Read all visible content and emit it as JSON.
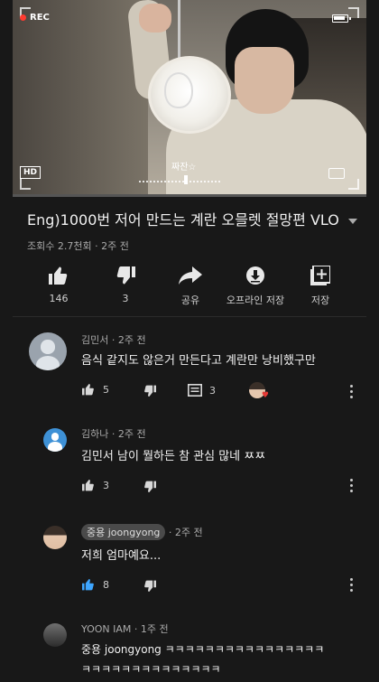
{
  "video": {
    "rec_label": "REC",
    "hd_label": "HD",
    "caption": "짜잔☆",
    "progress_fraction": 0.0
  },
  "meta": {
    "title": "Eng)1000번 저어 만드는 계란 오믈렛 절망편 VLOG",
    "views": "조회수 2.7천회 · 2주 전"
  },
  "actions": [
    {
      "id": "like",
      "icon": "thumbs-up-icon",
      "label": "146"
    },
    {
      "id": "dislike",
      "icon": "thumbs-down-icon",
      "label": "3"
    },
    {
      "id": "share",
      "icon": "share-icon",
      "label": "공유"
    },
    {
      "id": "download",
      "icon": "download-icon",
      "label": "오프라인 저장"
    },
    {
      "id": "save",
      "icon": "playlist-add-icon",
      "label": "저장"
    }
  ],
  "comments": [
    {
      "author": "김민서 · 2주 전",
      "text": "음식 같지도 않은거 만든다고 계란만 낭비했구만",
      "likes": "5",
      "replies": "3",
      "hearted": true
    },
    {
      "author": "김하나 · 2주 전",
      "text": "김민서 남이 뭘하든 참 관심 많네 ㅉㅉ",
      "likes": "3"
    },
    {
      "author": "중용 joongyong",
      "time": "· 2주 전",
      "text": "저희 엄마예요...",
      "likes": "8"
    },
    {
      "author": "YOON IAM · 1주 전",
      "text_line1": "중용 joongyong ㅋㅋㅋㅋㅋㅋㅋㅋㅋㅋㅋㅋㅋㅋㅋㅋ",
      "text_line2": "ㅋㅋㅋㅋㅋㅋㅋㅋㅋㅋㅋㅋㅋㅋ"
    }
  ],
  "colors": {
    "background": "#181818",
    "progress": "#ff0000",
    "liked_blue": "#3ea6ff"
  }
}
